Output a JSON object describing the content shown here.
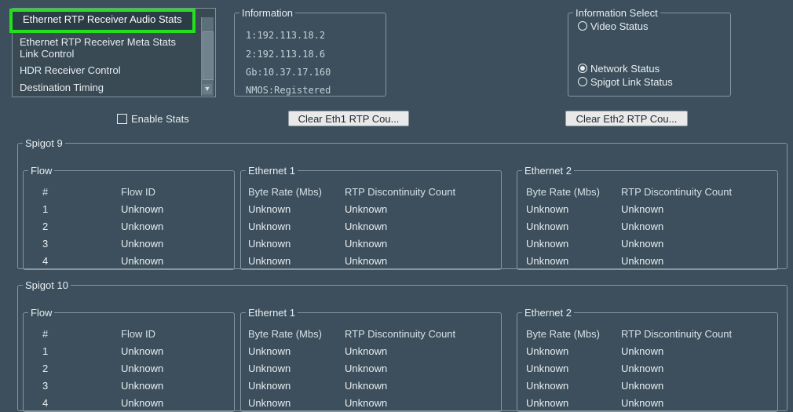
{
  "nav": {
    "items": [
      {
        "label": "Ethernet RTP Receiver Audio Stats",
        "selected": true
      },
      {
        "label": "Ethernet RTP Receiver Meta Stats"
      },
      {
        "label": "Link Control"
      },
      {
        "label": "HDR Receiver Control"
      },
      {
        "label": "Destination Timing"
      }
    ]
  },
  "information": {
    "title": "Information",
    "lines": [
      "1:192.113.18.2",
      "2:192.113.18.6",
      "Gb:10.37.17.160",
      "NMOS:Registered"
    ]
  },
  "information_select": {
    "title": "Information Select",
    "options": [
      {
        "label": "Video Status",
        "checked": false
      },
      {
        "label": "Network Status",
        "checked": true
      },
      {
        "label": "Spigot Link Status",
        "checked": false
      }
    ]
  },
  "controls": {
    "enable_stats": "Enable Stats",
    "enable_stats_checked": false,
    "clear_eth1": "Clear Eth1 RTP Cou...",
    "clear_eth2": "Clear Eth2 RTP Cou..."
  },
  "spigots": [
    {
      "title": "Spigot 9",
      "flow": {
        "title": "Flow",
        "col_num": "#",
        "col_id": "Flow ID",
        "rows": [
          [
            "1",
            "Unknown"
          ],
          [
            "2",
            "Unknown"
          ],
          [
            "3",
            "Unknown"
          ],
          [
            "4",
            "Unknown"
          ]
        ]
      },
      "eth1": {
        "title": "Ethernet 1",
        "col_rate": "Byte Rate (Mbs)",
        "col_disc": "RTP Discontinuity Count",
        "rows": [
          [
            "Unknown",
            "Unknown"
          ],
          [
            "Unknown",
            "Unknown"
          ],
          [
            "Unknown",
            "Unknown"
          ],
          [
            "Unknown",
            "Unknown"
          ]
        ]
      },
      "eth2": {
        "title": "Ethernet 2",
        "col_rate": "Byte Rate (Mbs)",
        "col_disc": "RTP Discontinuity Count",
        "rows": [
          [
            "Unknown",
            "Unknown"
          ],
          [
            "Unknown",
            "Unknown"
          ],
          [
            "Unknown",
            "Unknown"
          ],
          [
            "Unknown",
            "Unknown"
          ]
        ]
      }
    },
    {
      "title": "Spigot 10",
      "flow": {
        "title": "Flow",
        "col_num": "#",
        "col_id": "Flow ID",
        "rows": [
          [
            "1",
            "Unknown"
          ],
          [
            "2",
            "Unknown"
          ],
          [
            "3",
            "Unknown"
          ],
          [
            "4",
            "Unknown"
          ]
        ]
      },
      "eth1": {
        "title": "Ethernet 1",
        "col_rate": "Byte Rate (Mbs)",
        "col_disc": "RTP Discontinuity Count",
        "rows": [
          [
            "Unknown",
            "Unknown"
          ],
          [
            "Unknown",
            "Unknown"
          ],
          [
            "Unknown",
            "Unknown"
          ],
          [
            "Unknown",
            "Unknown"
          ]
        ]
      },
      "eth2": {
        "title": "Ethernet 2",
        "col_rate": "Byte Rate (Mbs)",
        "col_disc": "RTP Discontinuity Count",
        "rows": [
          [
            "Unknown",
            "Unknown"
          ],
          [
            "Unknown",
            "Unknown"
          ],
          [
            "Unknown",
            "Unknown"
          ],
          [
            "Unknown",
            "Unknown"
          ]
        ]
      }
    }
  ]
}
